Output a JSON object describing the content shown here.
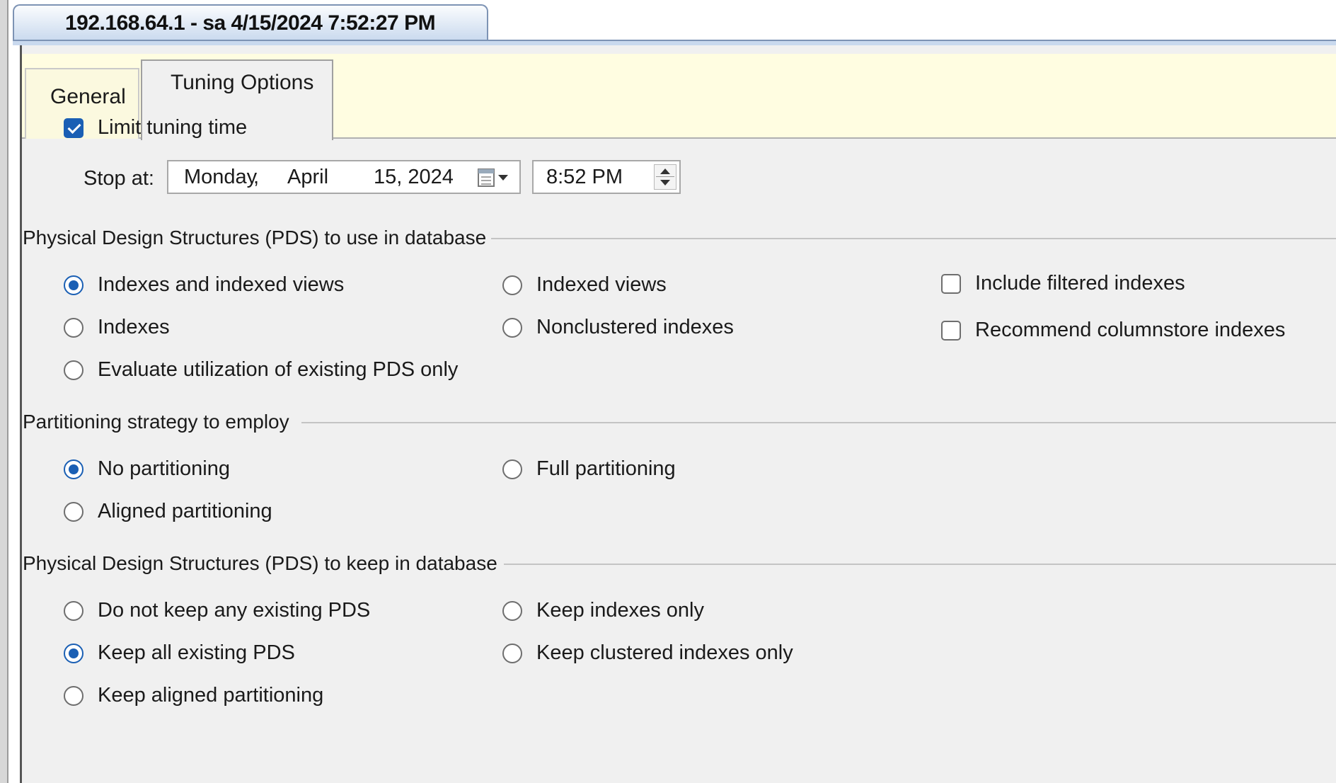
{
  "window_tab": {
    "title": "192.168.64.1 - sa 4/15/2024 7:52:27 PM"
  },
  "tabs": [
    {
      "label": "General"
    },
    {
      "label": "Tuning Options"
    }
  ],
  "limit_tuning": {
    "label": "Limit tuning time",
    "checked": true
  },
  "stop_at": {
    "label": "Stop at:",
    "day": "Monday",
    "sep": ",",
    "month": "April",
    "date_year": "15, 2024",
    "time": "8:52 PM"
  },
  "pds_use": {
    "title": "Physical Design Structures (PDS) to use in database",
    "options": [
      {
        "label": "Indexes and indexed views",
        "selected": true
      },
      {
        "label": "Indexed views",
        "selected": false
      },
      {
        "label": "Indexes",
        "selected": false
      },
      {
        "label": "Nonclustered indexes",
        "selected": false
      },
      {
        "label": "Evaluate utilization of existing PDS only",
        "selected": false
      }
    ],
    "checks": [
      {
        "label": "Include filtered indexes",
        "checked": false
      },
      {
        "label": "Recommend columnstore indexes",
        "checked": false
      }
    ]
  },
  "partitioning": {
    "title": "Partitioning strategy to employ",
    "options": [
      {
        "label": "No partitioning",
        "selected": true
      },
      {
        "label": "Full partitioning",
        "selected": false
      },
      {
        "label": "Aligned partitioning",
        "selected": false
      }
    ]
  },
  "pds_keep": {
    "title": "Physical Design Structures (PDS) to keep in database",
    "options": [
      {
        "label": "Do not keep any existing PDS",
        "selected": false
      },
      {
        "label": "Keep indexes only",
        "selected": false
      },
      {
        "label": "Keep all existing PDS",
        "selected": true
      },
      {
        "label": "Keep clustered indexes only",
        "selected": false
      },
      {
        "label": "Keep aligned partitioning",
        "selected": false
      }
    ]
  },
  "colors": {
    "accent": "#1a5fb4",
    "panel_bg": "#f0f0f0",
    "tabstrip_bg": "#fffde1"
  }
}
